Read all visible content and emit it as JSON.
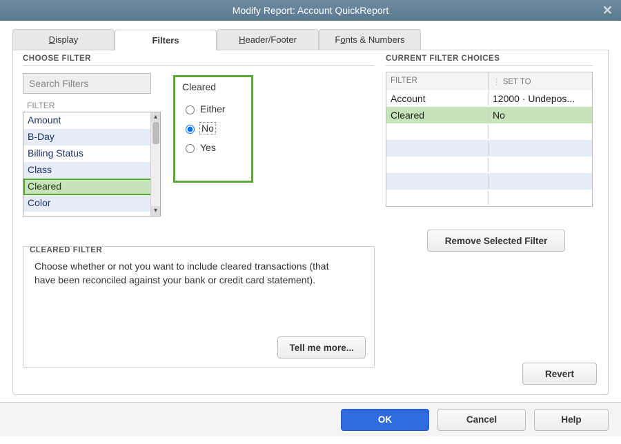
{
  "title": "Modify Report: Account QuickReport",
  "tabs": {
    "display": "Display",
    "filters": "Filters",
    "header_footer": "Header/Footer",
    "fonts_numbers": "Fonts & Numbers"
  },
  "choose_filter": {
    "label": "CHOOSE FILTER",
    "search_placeholder": "Search Filters",
    "filter_col": "FILTER",
    "items": [
      "Amount",
      "B-Day",
      "Billing Status",
      "Class",
      "Cleared",
      "Color"
    ],
    "selected": "Cleared"
  },
  "radio": {
    "title": "Cleared",
    "options": [
      "Either",
      "No",
      "Yes"
    ],
    "selected": "No"
  },
  "desc": {
    "label": "CLEARED FILTER",
    "text": "Choose whether or not you want to include cleared transactions (that have been reconciled against your bank or credit card statement).",
    "tell_more": "Tell me more..."
  },
  "choices": {
    "label": "CURRENT FILTER CHOICES",
    "col_filter": "FILTER",
    "col_setto": "SET TO",
    "rows": [
      {
        "filter": "Account",
        "setto": "12000 · Undepos..."
      },
      {
        "filter": "Cleared",
        "setto": "No"
      }
    ],
    "remove": "Remove Selected Filter"
  },
  "buttons": {
    "revert": "Revert",
    "ok": "OK",
    "cancel": "Cancel",
    "help": "Help"
  }
}
